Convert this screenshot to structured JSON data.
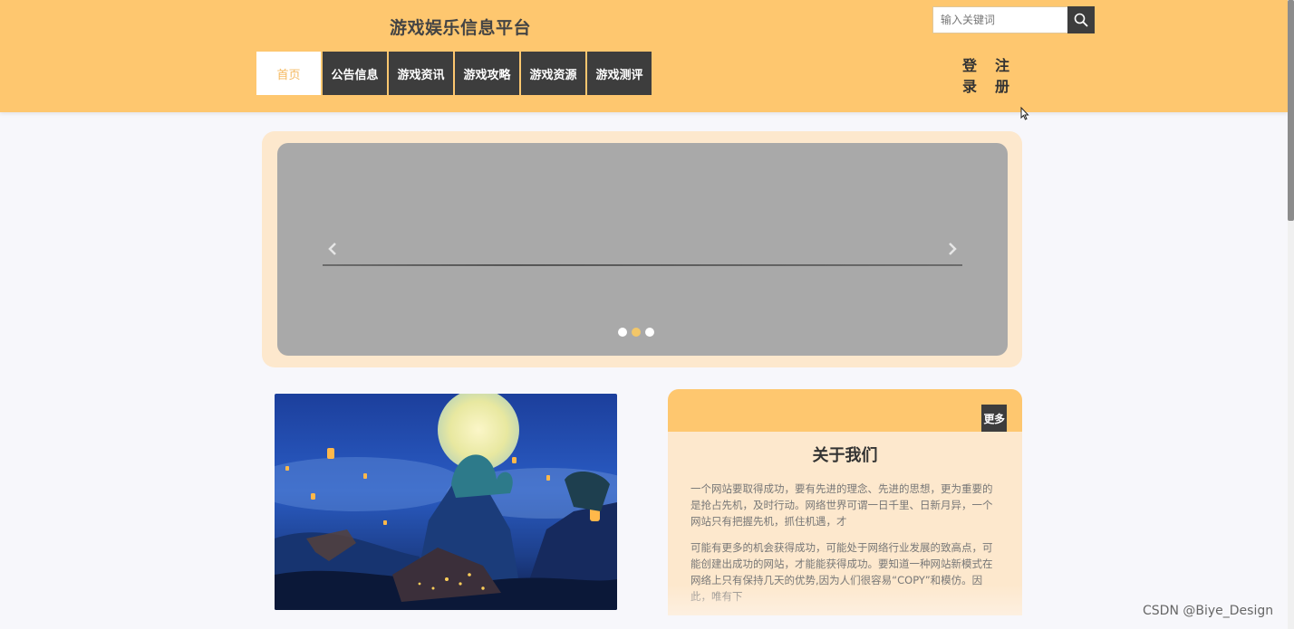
{
  "header": {
    "title": "游戏娱乐信息平台",
    "search_placeholder": "输入关键词",
    "nav": [
      {
        "label": "首页",
        "active": true
      },
      {
        "label": "公告信息",
        "active": false
      },
      {
        "label": "游戏资讯",
        "active": false
      },
      {
        "label": "游戏攻略",
        "active": false
      },
      {
        "label": "游戏资源",
        "active": false
      },
      {
        "label": "游戏测评",
        "active": false
      }
    ],
    "login_label": "登录",
    "register_label": "注册"
  },
  "carousel": {
    "slide_count": 3,
    "active_index": 1,
    "prev_icon": "chevron-left-icon",
    "next_icon": "chevron-right-icon"
  },
  "featured_image": {
    "icon": "fantasy-night-landscape-image"
  },
  "about": {
    "title": "关于我们",
    "more_label": "更多",
    "paragraphs": [
      "一个网站要取得成功，要有先进的理念、先进的思想，更为重要的是抢占先机，及时行动。网络世界可谓一日千里、日新月异，一个网站只有把握先机，抓住机遇，才",
      "可能有更多的机会获得成功，可能处于网络行业发展的致高点，可能创建出成功的网站，才能能获得成功。要知道一种网站新模式在网络上只有保持几天的优势,因为人们很容易“COPY”和模仿。因此，唯有下"
    ]
  },
  "watermark": "CSDN @Biye_Design",
  "colors": {
    "header_bg": "#fec76f",
    "nav_bg": "#3d3d3d",
    "accent": "#f5b960",
    "panel_bg": "#fde8cd"
  }
}
